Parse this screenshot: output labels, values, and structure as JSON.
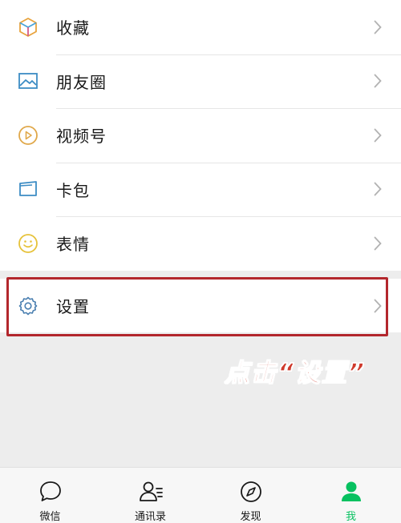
{
  "menu": {
    "items": [
      {
        "label": "收藏",
        "icon": "cube-icon"
      },
      {
        "label": "朋友圈",
        "icon": "image-icon"
      },
      {
        "label": "视频号",
        "icon": "video-channel-icon"
      },
      {
        "label": "卡包",
        "icon": "card-icon"
      },
      {
        "label": "表情",
        "icon": "smiley-icon"
      }
    ],
    "settings": {
      "label": "设置",
      "icon": "gear-icon"
    }
  },
  "annotation": {
    "text": "点击“设置”",
    "color": "#cf3a2c"
  },
  "tabbar": {
    "tabs": [
      {
        "label": "微信",
        "icon": "chat-bubble-icon"
      },
      {
        "label": "通讯录",
        "icon": "contacts-icon"
      },
      {
        "label": "发现",
        "icon": "compass-icon"
      },
      {
        "label": "我",
        "icon": "person-icon",
        "active": true
      }
    ],
    "active_color": "#07c160"
  }
}
